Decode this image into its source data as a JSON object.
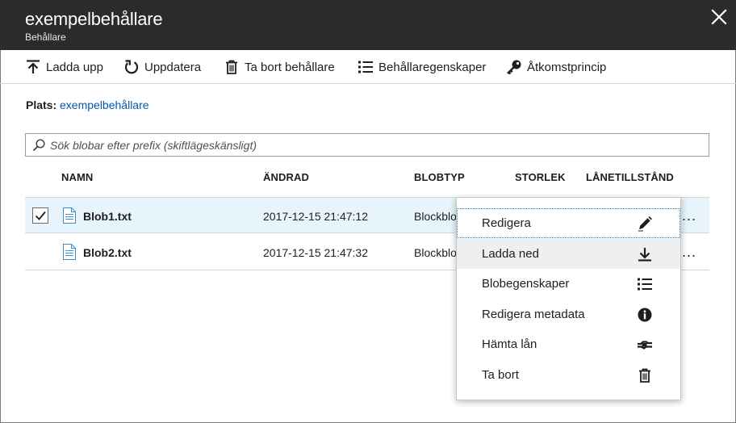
{
  "header": {
    "title": "exempelbehållare",
    "subtitle": "Behållare"
  },
  "toolbar": {
    "upload": "Ladda upp",
    "refresh": "Uppdatera",
    "delete_container": "Ta bort behållare",
    "container_properties": "Behållaregenskaper",
    "access_policy": "Åtkomstprincip"
  },
  "location": {
    "label": "Plats:",
    "value": "exempelbehållare"
  },
  "search": {
    "placeholder": "Sök blobar efter prefix (skiftlägeskänsligt)",
    "value": ""
  },
  "table": {
    "columns": [
      "NAMN",
      "ÄNDRAD",
      "BLOBTYP",
      "STORLEK",
      "LÅNETILLSTÅND"
    ],
    "rows": [
      {
        "selected": true,
        "name": "Blob1.txt",
        "modified": "2017-12-15 21:47:12",
        "blobtype": "Blockblob"
      },
      {
        "selected": false,
        "name": "Blob2.txt",
        "modified": "2017-12-15 21:47:32",
        "blobtype": "Blockblob"
      }
    ],
    "more_label": "..."
  },
  "context_menu": {
    "items": [
      {
        "label": "Redigera",
        "icon": "pencil-icon"
      },
      {
        "label": "Ladda ned",
        "icon": "download-icon"
      },
      {
        "label": "Blobegenskaper",
        "icon": "list-icon"
      },
      {
        "label": "Redigera metadata",
        "icon": "info-icon"
      },
      {
        "label": "Hämta lån",
        "icon": "lease-icon"
      },
      {
        "label": "Ta bort",
        "icon": "trash-icon"
      }
    ]
  },
  "colors": {
    "header_bg": "#2b2b2b",
    "link": "#0058ad",
    "selected_row": "#e8f4fb",
    "focus_outline": "#1a86c7"
  }
}
